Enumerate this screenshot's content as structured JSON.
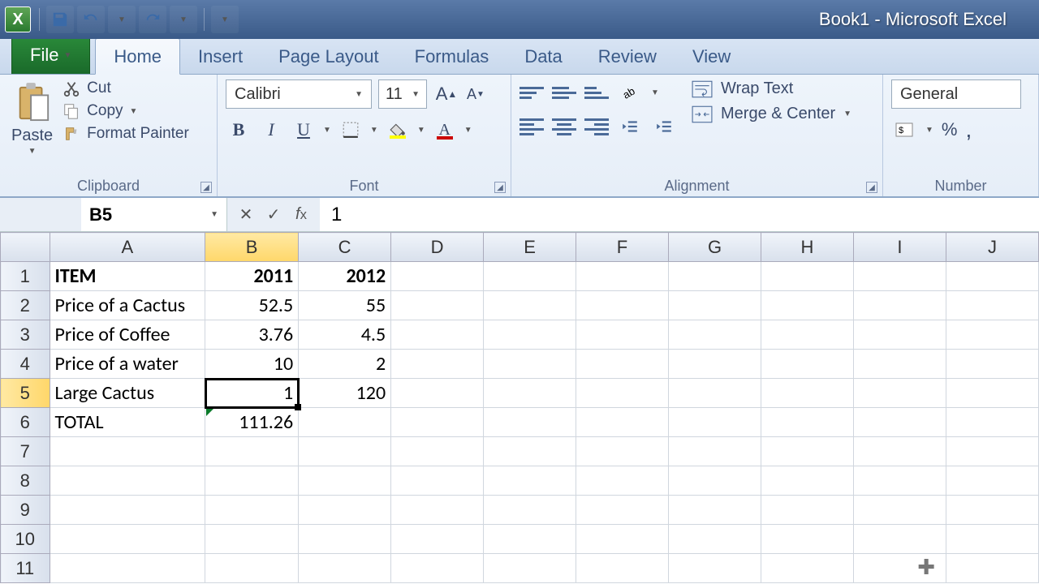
{
  "window": {
    "title": "Book1 - Microsoft Excel"
  },
  "tabs": {
    "file": "File",
    "items": [
      "Home",
      "Insert",
      "Page Layout",
      "Formulas",
      "Data",
      "Review",
      "View"
    ],
    "active": "Home"
  },
  "ribbon": {
    "clipboard": {
      "label": "Clipboard",
      "paste": "Paste",
      "cut": "Cut",
      "copy": "Copy",
      "format_painter": "Format Painter"
    },
    "font": {
      "label": "Font",
      "name": "Calibri",
      "size": "11"
    },
    "alignment": {
      "label": "Alignment",
      "wrap": "Wrap Text",
      "merge": "Merge & Center"
    },
    "number": {
      "label": "Number",
      "format": "General"
    }
  },
  "formula_bar": {
    "name_box": "B5",
    "formula": "1"
  },
  "columns": [
    "A",
    "B",
    "C",
    "D",
    "E",
    "F",
    "G",
    "H",
    "I",
    "J"
  ],
  "active": {
    "col": "B",
    "row": 5
  },
  "cells": {
    "A1": {
      "v": "ITEM",
      "align": "left",
      "bold": true
    },
    "B1": {
      "v": "2011",
      "align": "right",
      "bold": true
    },
    "C1": {
      "v": "2012",
      "align": "right",
      "bold": true
    },
    "A2": {
      "v": "Price of a Cactus",
      "align": "left"
    },
    "B2": {
      "v": "52.5",
      "align": "right"
    },
    "C2": {
      "v": "55",
      "align": "right"
    },
    "A3": {
      "v": "Price of Coffee",
      "align": "left"
    },
    "B3": {
      "v": "3.76",
      "align": "right"
    },
    "C3": {
      "v": "4.5",
      "align": "right"
    },
    "A4": {
      "v": "Price of a water",
      "align": "left"
    },
    "B4": {
      "v": "10",
      "align": "right"
    },
    "C4": {
      "v": "2",
      "align": "right"
    },
    "A5": {
      "v": "Large Cactus",
      "align": "left"
    },
    "B5": {
      "v": "1",
      "align": "right"
    },
    "C5": {
      "v": "120",
      "align": "right"
    },
    "A6": {
      "v": "TOTAL",
      "align": "left"
    },
    "B6": {
      "v": "111.26",
      "align": "right",
      "err": true
    }
  },
  "row_count": 11
}
